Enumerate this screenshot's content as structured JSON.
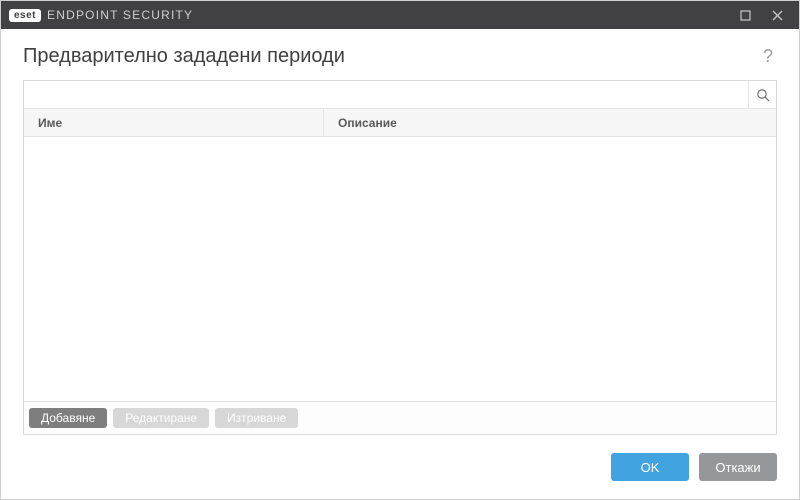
{
  "titlebar": {
    "brand_badge": "eset",
    "brand_text": "ENDPOINT SECURITY"
  },
  "header": {
    "title": "Предварително зададени периоди",
    "help": "?"
  },
  "search": {
    "value": "",
    "placeholder": ""
  },
  "table": {
    "columns": {
      "name": "Име",
      "description": "Описание"
    },
    "rows": []
  },
  "actions": {
    "add": "Добавяне",
    "edit": "Редактиране",
    "delete": "Изтриване"
  },
  "footer": {
    "ok": "OK",
    "cancel": "Откажи"
  }
}
